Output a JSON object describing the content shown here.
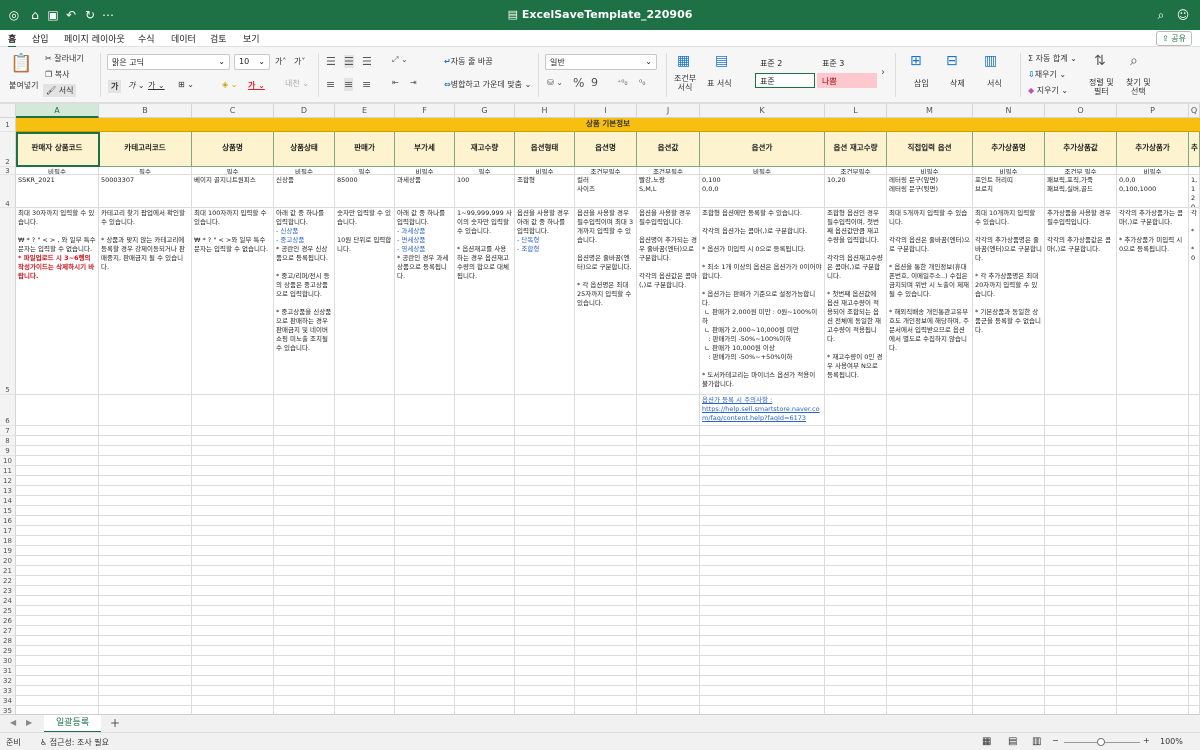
{
  "app": {
    "title": "ExcelSaveTemplate_220906"
  },
  "menu": {
    "tabs": [
      "홈",
      "삽입",
      "페이지 레이아웃",
      "수식",
      "데이터",
      "검토",
      "보기"
    ],
    "share": "공유"
  },
  "ribbon": {
    "paste": "붙여넣기",
    "cut": "잘라내기",
    "copy": "복사",
    "format_painter": "서식",
    "font_name": "맑은 고딕",
    "font_size": "10",
    "wrap_text": "자동 줄 바꿈",
    "merge_center": "병합하고 가운데 맞춤",
    "number_format": "일반",
    "conditional_format": "조건부\n서식",
    "table_format": "표 서식",
    "style1": "표준 2",
    "style2": "표준 3",
    "style3": "표준",
    "style4": "나쁨",
    "insert": "삽입",
    "delete": "삭제",
    "format": "서식",
    "autosum": "자동 합계",
    "fill": "채우기",
    "clear": "지우기",
    "sort_filter": "정렬 및\n필터",
    "find_select": "찾기 및\n선택"
  },
  "grid": {
    "columns": [
      "A",
      "B",
      "C",
      "D",
      "E",
      "F",
      "G",
      "H",
      "I",
      "J",
      "K",
      "L",
      "M",
      "N",
      "O",
      "P",
      "Q"
    ],
    "banner": "상품 기본정보",
    "headers": [
      "판매자 상품코드",
      "카테고리코드",
      "상품명",
      "상품상태",
      "판매가",
      "부가세",
      "재고수량",
      "옵션형태",
      "옵션명",
      "옵션값",
      "옵션가",
      "옵션 재고수량",
      "직접입력 옵션",
      "추가상품명",
      "추가상품값",
      "추가상품가",
      "추"
    ],
    "required": [
      "비필수",
      "필수",
      "필수",
      "비필수",
      "필수",
      "비필수",
      "필수",
      "비필수",
      "조건부필수",
      "조건부필수",
      "비필수",
      "조건부필수",
      "비필수",
      "비필수",
      "조건부 필수",
      "비필수",
      ""
    ],
    "examples": [
      "SSKR_2021",
      "50003307",
      "베이지 골지니트원피스",
      "신상품",
      "85000",
      "과세상품",
      "100",
      "조합형",
      "컬러\n사이즈",
      "빨강,노랑\nS,M,L",
      "0,100\n0,0,0",
      "10,20",
      "레터링 문구(앞면)\n레터링 문구(뒷면)",
      "포인트 허리띠\n브로치",
      "패브릭,포직,가죽\n패브릭,실버,골드",
      "0,0,0\n0,100,1000",
      "1,1\n20,"
    ],
    "notes": [
      "최대 30자까지 입력할 수 있습니다.\n\n₩ * ? \" < > , 와 일부 특수문자는 입력할 수 없습니다.",
      "카테고리 찾기 팝업에서 확인할 수 있습니다.\n\n* 상품과 맞지 않는 카테고리에 등록할 경우 강제이동되거나 판매중지, 판매금지 될 수 있습니다.",
      "최대 100자까지 입력할 수 있습니다.\n\n₩ * ? \" < >와 일부 특수문자는 입력할 수 없습니다.",
      "아래 값 중 하나를 입력합니다.",
      "숫자만 입력할 수 있습니다.\n\n10원 단위로 입력합니다.",
      "아래 값 중 하나를 입력합니다.",
      "1~99,999,999 사이의 숫자만 입력할 수 있습니다.\n\n* 옵션재고를 사용하는 경우 옵션재고수량의 합으로 대체됩니다.",
      "옵션을 사용할 경우 아래 값 중 하나를 입력합니다.",
      "옵션을 사용할 경우 필수입력이며 최대 3개까지 입력할 수 있습니다.\n\n옵션명은 줄바꿈(엔터)으로 구분합니다.\n\n* 각 옵션명은 최대 25자까지 입력할 수 있습니다.",
      "옵션을 사용할 경우 필수입력입니다.\n\n옵션명이 추가되는 경우 줄바꿈(엔터)으로 구분합니다.\n\n각각의 옵션값은 콤마(,)로 구분합니다.",
      "조합형 옵션에만 등록할 수 있습니다.\n\n각각의 옵션가는 콤마(,)로 구분합니다.\n\n* 옵션가 미입력 시 0으로 등록됩니다.\n\n* 최소 1개 이상의 옵션은 옵션가가 0이어야 합니다.\n\n* 옵션가는 판매가 기준으로 설정가능합니다.\n ㄴ 판매가 2,000원 미만 : 0원~100%이하\n ㄴ 판매가 2,000~10,000원 미만\n   : 판매가의 -50%~100%이하\n ㄴ 판매가 10,000원 이상\n   : 판매가의 -50%~+50%이하\n\n* 도서카테고리는 마이너스 옵션가 적용이 불가합니다.",
      "조합형 옵션인 경우 필수입력이며, 첫번째 옵션값만큼 재고수량을 입력합니다.\n\n각각의 옵션재고수량은 콤마(,)로 구분합니다.\n\n* 첫번째 옵션값에 옵션 재고수량이 적용되어 조합되는 옵션 전체에 동일한 재고수량이 적용됩니다.\n\n* 재고수량이 0인 경우 사용여부 N으로 등록됩니다.",
      "최대 5개까지 입력할 수 있습니다.\n\n각각의 옵션은 줄바꿈(엔터)으로 구분합니다.\n\n* 옵션을 통한 개인정보(휴대폰번호, 이메일주소..) 수집은 금지되며 위반 시 노출이 제재될 수 있습니다.\n\n* 해외직배송 개인통관고유부호도 개인정보에 해당하며, 주문서에서 입력받으므로 옵션에서 별도로 수집하지 않습니다.",
      "최대 10개까지 입력할 수 있습니다.\n\n각각의 추가상품명은 줄바꿈(엔터)으로 구분합니다.\n\n* 각 추가상품명은 최대 20자까지 입력할 수 있습니다.\n\n* 기본상품과 동일한 상품군을 등록할 수 없습니다.",
      "추가상품을 사용할 경우 필수입력입니다.\n\n각각의 추가상품값은 콤마(,)로 구분합니다.",
      "각각의 추가상품가는 콤마(,)로 구분합니다.\n\n* 추가상품가 미입력 시 0으로 등록됩니다.",
      "각 \n \n* \n\n* \n0"
    ],
    "note_a_red": "* 파일업로드 시 3~6행의 작성가이드는 삭제하시기 바랍니다.",
    "state_options": [
      "- 신상품",
      "- 중고상품"
    ],
    "state_note2": "* 공란인 경우 신상품으로 등록됩니다.\n\n* 중고/리퍼/전시 등의 상품은 중고상품으로 입력합니다.\n\n* 중고상품을 신상품으로 판매하는 경우 판매금지 및 네이버쇼핑 미노출 조치될 수 있습니다.",
    "tax_options": [
      "- 과세상품",
      "- 면세상품",
      "- 영세상품"
    ],
    "tax_note2": "* 공란인 경우 과세상품으로 등록됩니다.",
    "option_type_options": [
      "- 단독형",
      "- 조합형"
    ],
    "option_link": "옵션가 등록 시 주의사항 :\nhttps://help.sell.smartstore.naver.com/faq/content.help?faqId=6173",
    "row_numbers": [
      "1",
      "2",
      "3",
      "4",
      "5",
      "6",
      "7",
      "8",
      "9",
      "10",
      "11",
      "12",
      "13",
      "14",
      "15",
      "16",
      "17",
      "18",
      "19",
      "20",
      "21",
      "22",
      "23",
      "24",
      "25",
      "26",
      "27",
      "28",
      "29",
      "30",
      "31",
      "32",
      "33",
      "34",
      "35"
    ]
  },
  "sheets": {
    "active": "일괄등록",
    "add": "+"
  },
  "status": {
    "ready": "준비",
    "accessibility": "접근성: 조사 필요",
    "zoom": "100%"
  }
}
